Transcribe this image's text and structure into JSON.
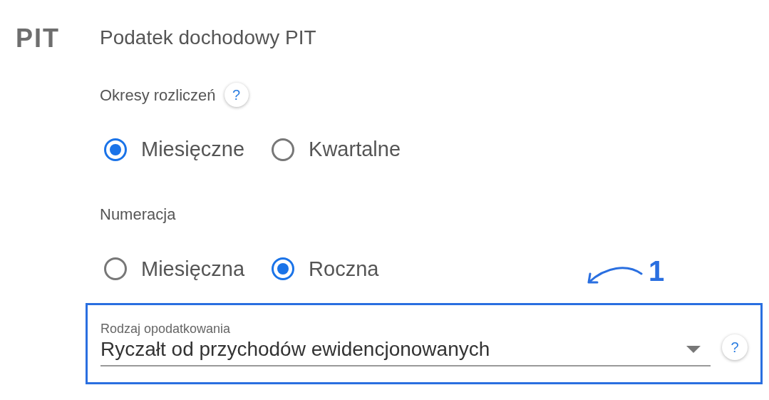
{
  "section": {
    "logo": "PIT",
    "title": "Podatek dochodowy PIT"
  },
  "radio_groups": [
    {
      "label": "Okresy rozliczeń",
      "help": "?",
      "options": [
        {
          "label": "Miesięczne",
          "selected": true
        },
        {
          "label": "Kwartalne",
          "selected": false
        }
      ]
    },
    {
      "label": "Numeracja",
      "options": [
        {
          "label": "Miesięczna",
          "selected": false
        },
        {
          "label": "Roczna",
          "selected": true
        }
      ]
    }
  ],
  "select": {
    "label": "Rodzaj opodatkowania",
    "value": "Ryczałt od przychodów ewidencjonowanych",
    "help": "?"
  },
  "annotation": {
    "number": "1"
  }
}
